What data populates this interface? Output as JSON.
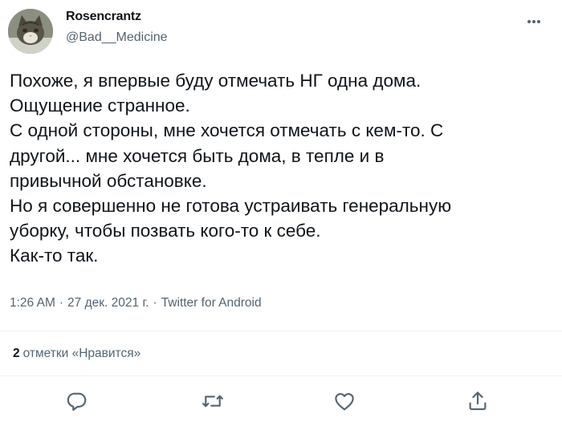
{
  "author": {
    "name": "Rosencrantz",
    "handle": "@Bad__Medicine"
  },
  "tweet": {
    "lines": [
      "Похоже, я впервые буду отмечать НГ одна дома.",
      "Ощущение странное.",
      "С одной стороны, мне хочется отмечать с кем-то. С",
      "другой... мне хочется быть дома, в тепле и в",
      "привычной обстановке.",
      "Но я совершенно не готова устраивать генеральную",
      "уборку, чтобы позвать кого-то к себе.",
      "Как-то так."
    ]
  },
  "meta": {
    "time": "1:26 AM",
    "separator": "·",
    "date": "27 дек. 2021 г.",
    "source": "Twitter for Android"
  },
  "likes": {
    "count": "2",
    "label": "отметки «Нравится»"
  },
  "icons": {
    "more": "more-horizontal-icon",
    "reply": "reply-icon",
    "retweet": "retweet-icon",
    "like": "heart-icon",
    "share": "share-icon"
  },
  "colors": {
    "text_primary": "#0f1419",
    "text_secondary": "#536471",
    "divider": "#eff3f4"
  }
}
